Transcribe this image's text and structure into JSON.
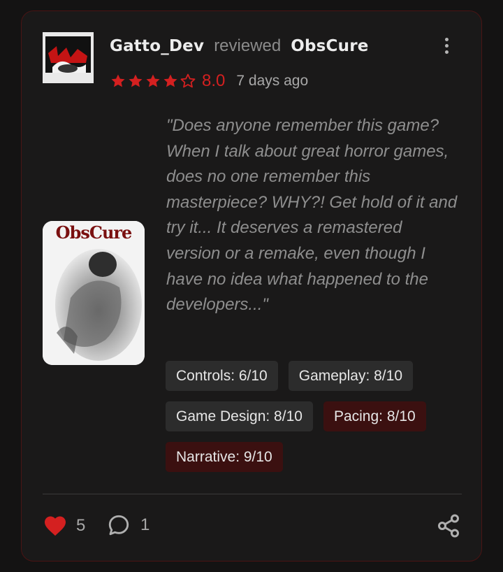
{
  "review": {
    "username": "Gatto_Dev",
    "verb": "reviewed",
    "game_title": "ObsCure",
    "rating_stars": 4,
    "rating_max_stars": 5,
    "score": "8.0",
    "time_ago": "7 days ago",
    "quote": "\"Does anyone remember this game? When I talk about great horror games, does no one remember this masterpiece? WHY?! Get hold of it and try it... It deserves a remastered version or a remake, even though I have no idea what happened to the developers...\""
  },
  "cover": {
    "title": "ObsCure"
  },
  "tags": [
    {
      "label": "Controls: 6/10",
      "highlighted": false
    },
    {
      "label": "Gameplay: 8/10",
      "highlighted": false
    },
    {
      "label": "Game Design: 8/10",
      "highlighted": false
    },
    {
      "label": "Pacing: 8/10",
      "highlighted": true
    },
    {
      "label": "Narrative: 9/10",
      "highlighted": true
    }
  ],
  "footer": {
    "likes": "5",
    "comments": "1"
  },
  "icons": {
    "avatar": "avatar-image",
    "menu": "more-vertical-icon",
    "star": "star-icon",
    "like": "heart-icon",
    "comment": "comment-icon",
    "share": "share-icon"
  },
  "colors": {
    "accent": "#d42020",
    "card_border": "#4a1414",
    "tag_bg": "#2c2c2c",
    "tag_highlight_bg": "#3b1010"
  }
}
